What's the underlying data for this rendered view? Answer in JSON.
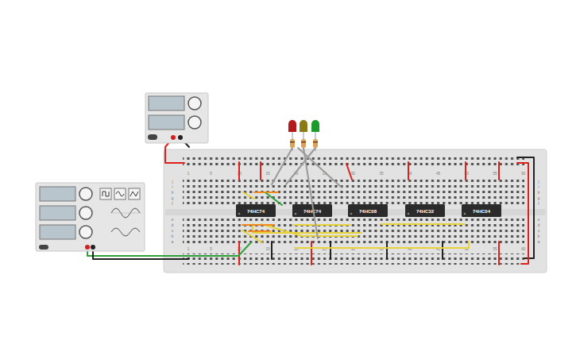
{
  "power_supply": {
    "powered": false
  },
  "function_generator": {
    "powered": false
  },
  "leds": [
    {
      "color": "#b3191b"
    },
    {
      "color": "#8c7a14"
    },
    {
      "color": "#1c9a2c"
    }
  ],
  "breadboard": {
    "column_numbers": [
      "1",
      "5",
      "10",
      "15",
      "20",
      "25",
      "30",
      "35",
      "40",
      "45",
      "50",
      "55",
      "60"
    ],
    "row_letters": [
      "j",
      "i",
      "h",
      "g",
      "f",
      "e",
      "d",
      "c",
      "b",
      "a"
    ]
  },
  "chips": [
    {
      "label": "74HC74"
    },
    {
      "label": "74HC74"
    },
    {
      "label": "74HC08"
    },
    {
      "label": "74HC32"
    },
    {
      "label": "74HC04"
    }
  ],
  "wires": [
    {
      "color": "#e0201c"
    },
    {
      "color": "#e0201c"
    },
    {
      "color": "#e0201c"
    },
    {
      "color": "#e0201c"
    },
    {
      "color": "#e0201c"
    },
    {
      "color": "#e0201c"
    },
    {
      "color": "#e0201c"
    },
    {
      "color": "#e0201c"
    },
    {
      "color": "#e0201c"
    },
    {
      "color": "#222222"
    },
    {
      "color": "#222222"
    },
    {
      "color": "#222222"
    },
    {
      "color": "#222222"
    },
    {
      "color": "#222222"
    },
    {
      "color": "#e0201c"
    },
    {
      "color": "#e0201c"
    },
    {
      "color": "#222222"
    },
    {
      "color": "#2ea03a"
    },
    {
      "color": "#222222"
    },
    {
      "color": "#e8d23a"
    },
    {
      "color": "#e8d23a"
    },
    {
      "color": "#e8d23a"
    },
    {
      "color": "#e8d23a"
    },
    {
      "color": "#e8d23a"
    },
    {
      "color": "#e8d23a"
    },
    {
      "color": "#e8d23a"
    },
    {
      "color": "#f08a1c"
    },
    {
      "color": "#f08a1c"
    },
    {
      "color": "#f08a1c"
    },
    {
      "color": "#2ea03a"
    },
    {
      "color": "#9a9a9a"
    },
    {
      "color": "#9a9a9a"
    },
    {
      "color": "#9a9a9a"
    },
    {
      "color": "#9a9a9a"
    }
  ]
}
